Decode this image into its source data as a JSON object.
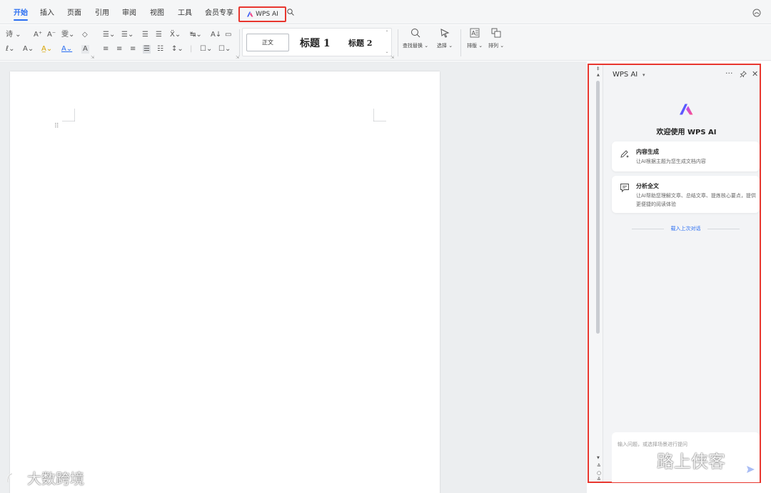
{
  "tabs": {
    "items": [
      {
        "label": "开始",
        "active": true
      },
      {
        "label": "插入",
        "active": false
      },
      {
        "label": "页面",
        "active": false
      },
      {
        "label": "引用",
        "active": false
      },
      {
        "label": "审阅",
        "active": false
      },
      {
        "label": "视图",
        "active": false
      },
      {
        "label": "工具",
        "active": false
      },
      {
        "label": "会员专享",
        "active": false
      }
    ],
    "wps_ai_label": "WPS AI",
    "accent_color": "#2a6ef2",
    "highlight_color": "#e8372f"
  },
  "ribbon": {
    "font_row1": [
      "诗 ⌄",
      "A⁺",
      "A⁻",
      "雯⌄",
      "◇"
    ],
    "font_row2": [
      "ℓ⌄",
      "A⌄",
      "A̲⌄",
      "A⌄",
      "A"
    ],
    "para_row1": [
      "☰⌄",
      "☰⌄",
      "☰",
      "☰",
      "Ẍ⌄",
      "↹⌄",
      "A↓",
      "▭"
    ],
    "para_row2": [
      "≡",
      "≡",
      "≡",
      "☰",
      "☷",
      "↕⌄",
      "|",
      "☐⌄",
      "☐⌄"
    ],
    "styles": {
      "normal": "正文",
      "heading1": "标题 1",
      "heading2": "标题 2"
    },
    "find_replace": "查找替换",
    "select": "选择",
    "layout": "排版",
    "arrange": "排列"
  },
  "ai_panel": {
    "title": "WPS AI",
    "welcome": "欢迎使用 WPS AI",
    "cards": [
      {
        "title": "内容生成",
        "desc": "让AI根据主题为您生成文档内容"
      },
      {
        "title": "分析全文",
        "desc": "让AI帮助您理解文章、总结文章、提炼核心要点，提供更便捷的阅读体验"
      }
    ],
    "history": "载入上次对话",
    "input_placeholder": "输入问题，或选择场景进行提问"
  },
  "watermarks": {
    "left": "大数跨境",
    "right": "路上侠客"
  }
}
